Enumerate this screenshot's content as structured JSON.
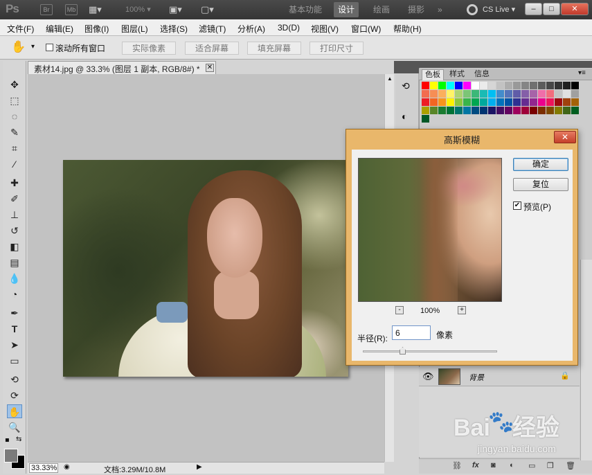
{
  "titlebar": {
    "logo": "Ps",
    "br_label": "Br",
    "mb_label": "Mb",
    "zoom_value": "100%",
    "workspaces": [
      "基本功能",
      "设计",
      "绘画",
      "摄影"
    ],
    "overflow": "»",
    "cs_live": "CS Live",
    "min": "–",
    "max": "□",
    "close": "✕"
  },
  "menu": [
    "文件(F)",
    "编辑(E)",
    "图像(I)",
    "图层(L)",
    "选择(S)",
    "滤镜(T)",
    "分析(A)",
    "3D(D)",
    "视图(V)",
    "窗口(W)",
    "帮助(H)"
  ],
  "options": {
    "scroll_all": "滚动所有窗口",
    "buttons": [
      "实际像素",
      "适合屏幕",
      "填充屏幕",
      "打印尺寸"
    ]
  },
  "document": {
    "tab_title": "素材14.jpg @ 33.3% (图层 1 副本, RGB/8#) *",
    "zoom": "33.33%",
    "doc_info": "文档:3.29M/10.8M"
  },
  "panels": {
    "tabs": [
      "色板",
      "样式",
      "信息"
    ],
    "swatch_colors": [
      "#ff0000",
      "#ffff00",
      "#00ff00",
      "#00ffff",
      "#0000ff",
      "#ff00ff",
      "#ffffff",
      "#ebebeb",
      "#d6d6d6",
      "#c2c2c2",
      "#adadad",
      "#999999",
      "#858585",
      "#707070",
      "#5c5c5c",
      "#474747",
      "#333333",
      "#1f1f1f",
      "#000000",
      "#f26c4f",
      "#f68e55",
      "#fbaf5c",
      "#fff467",
      "#acd372",
      "#7cc576",
      "#3bb878",
      "#1abbb4",
      "#00bff3",
      "#438ccb",
      "#5574b9",
      "#605ca8",
      "#855fa8",
      "#a763a8",
      "#f06ea9",
      "#f26d7d",
      "#c4c4c4",
      "#e0e0e0",
      "#a0a0a0",
      "#ed1c24",
      "#f26522",
      "#f7941d",
      "#fff200",
      "#8dc63f",
      "#39b54a",
      "#00a651",
      "#00a99d",
      "#00aeef",
      "#0072bc",
      "#0054a6",
      "#2e3192",
      "#662d91",
      "#92278f",
      "#ec008c",
      "#ed145b",
      "#9e0b0f",
      "#a0410d",
      "#a36209",
      "#aba000",
      "#598527",
      "#1a7b30",
      "#007236",
      "#00746b",
      "#0076a3",
      "#004b80",
      "#003471",
      "#1b1464",
      "#440e62",
      "#630460",
      "#9e005d",
      "#9e0039",
      "#790000",
      "#7b2e00",
      "#7d4900",
      "#827b00",
      "#406618",
      "#005e20",
      "#005826"
    ],
    "layer_name": "背景"
  },
  "dialog": {
    "title": "高斯模糊",
    "close": "✕",
    "ok": "确定",
    "reset": "复位",
    "preview": "预览(P)",
    "zoom_minus": "-",
    "zoom_plus": "+",
    "zoom_pct": "100%",
    "radius_label": "半径(R):",
    "radius_value": "6",
    "radius_unit": "像素"
  },
  "watermark": {
    "brand_left": "Bai",
    "brand_right": "经验",
    "url": "jingyan.baidu.com"
  }
}
